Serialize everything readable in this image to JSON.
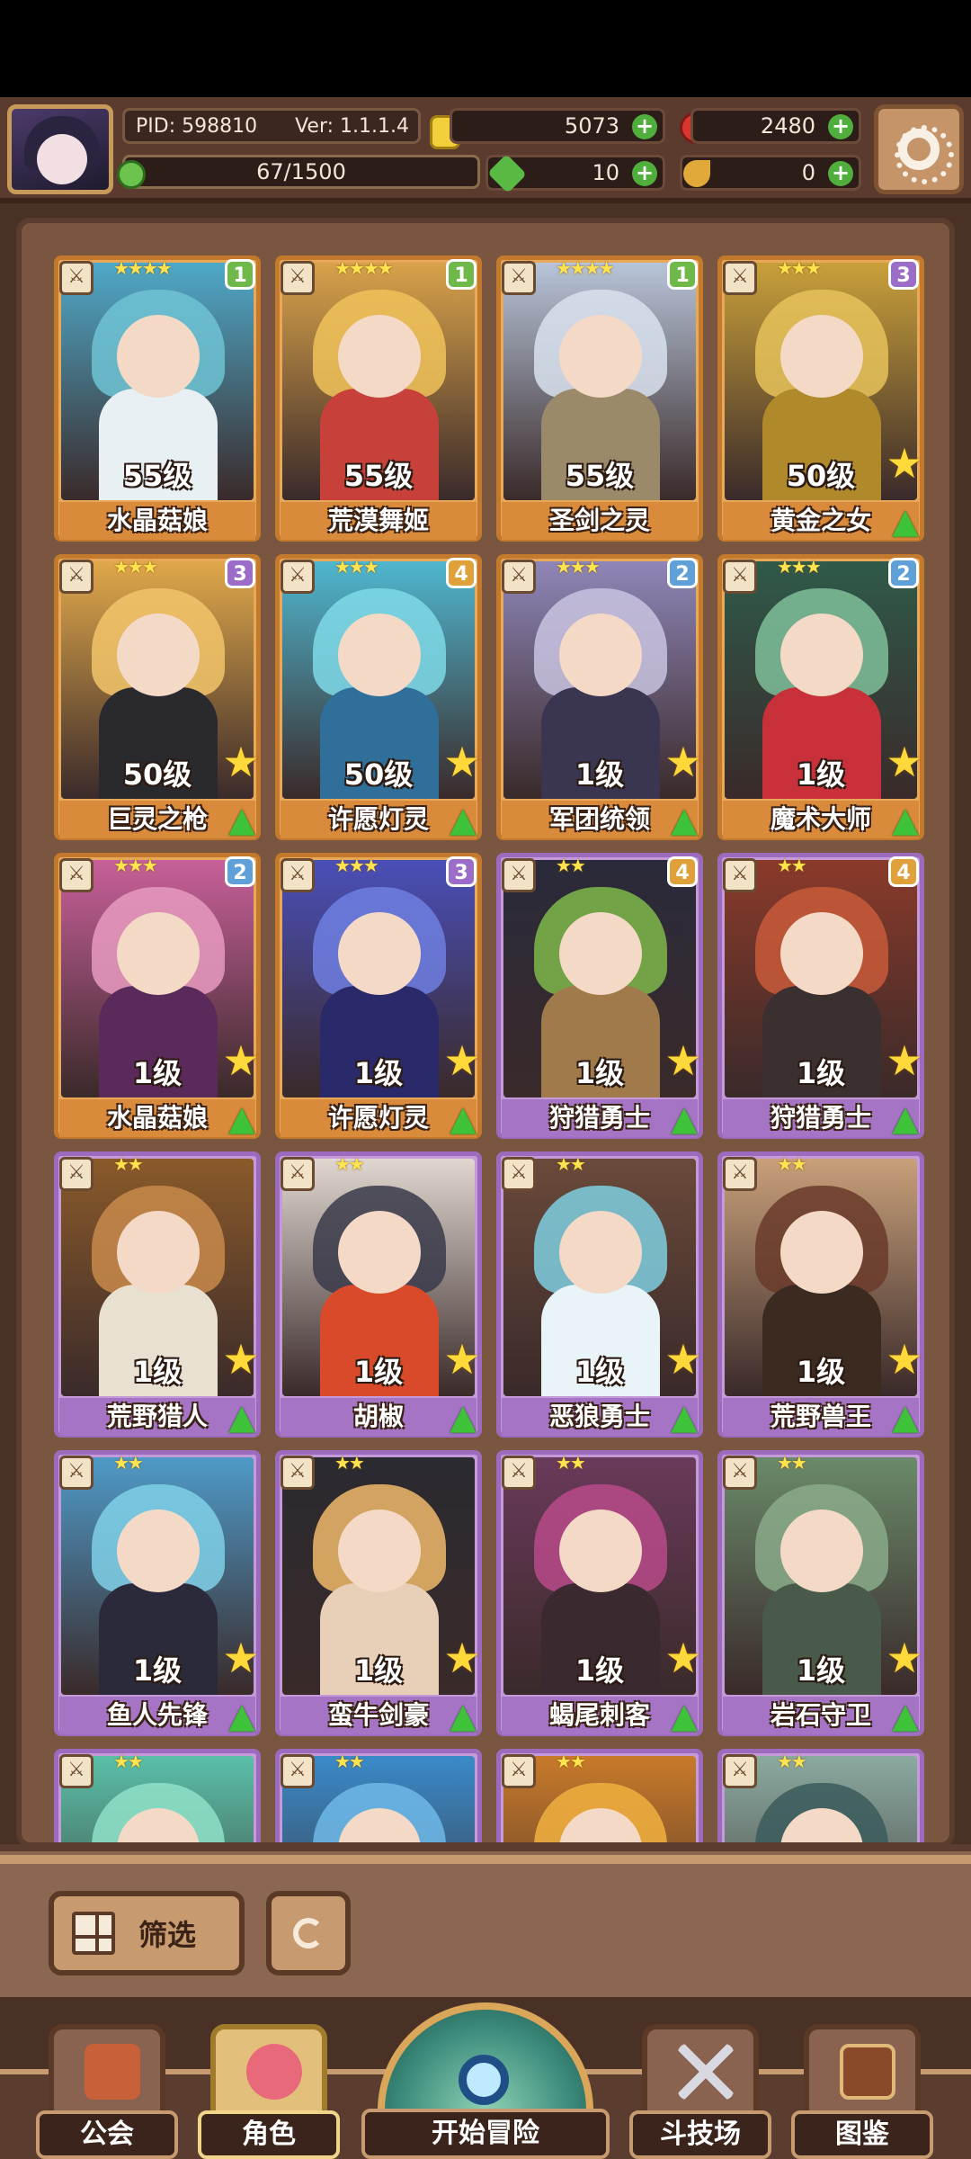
{
  "hud": {
    "pid": "PID: 598810",
    "version": "Ver: 1.1.1.4",
    "gold": "5073",
    "gems": "2480",
    "stamina": "67/1500",
    "clover": "10",
    "horn": "0"
  },
  "cards": [
    {
      "name": "水晶菇娘",
      "level": "55级",
      "stars": "★★★★",
      "badge": "1",
      "rarity": "gold",
      "badge_color": "#6fb84a",
      "art": [
        "#6fc3d4",
        "#4fa9c9",
        "#e8f0f4"
      ],
      "show_actions": false
    },
    {
      "name": "荒漠舞姬",
      "level": "55级",
      "stars": "★★★★",
      "badge": "1",
      "rarity": "gold",
      "badge_color": "#6fb84a",
      "art": [
        "#f0c25a",
        "#d9a24a",
        "#c8403a"
      ],
      "show_actions": false
    },
    {
      "name": "圣剑之灵",
      "level": "55级",
      "stars": "★★★★",
      "badge": "1",
      "rarity": "gold",
      "badge_color": "#6fb84a",
      "art": [
        "#d9e2ef",
        "#b7c4d8",
        "#9a8a6a"
      ],
      "show_actions": false
    },
    {
      "name": "黄金之女",
      "level": "50级",
      "stars": "★★★",
      "badge": "3",
      "rarity": "gold",
      "badge_color": "#9b6cc8",
      "art": [
        "#e6c25a",
        "#c9a03a",
        "#b08a2a"
      ],
      "show_actions": true
    },
    {
      "name": "巨灵之枪",
      "level": "50级",
      "stars": "★★★",
      "badge": "3",
      "rarity": "gold",
      "badge_color": "#9b6cc8",
      "art": [
        "#f2c46a",
        "#e0a84a",
        "#2a2a2e"
      ],
      "show_actions": true
    },
    {
      "name": "许愿灯灵",
      "level": "50级",
      "stars": "★★★",
      "badge": "4",
      "rarity": "gold",
      "badge_color": "#e0a03a",
      "art": [
        "#7fd9e6",
        "#4fb7cf",
        "#2f6f9a"
      ],
      "show_actions": true
    },
    {
      "name": "军团统领",
      "level": "1级",
      "stars": "★★★",
      "badge": "2",
      "rarity": "gold",
      "badge_color": "#5fa0d9",
      "art": [
        "#c9c3e0",
        "#8f86b8",
        "#3a3550"
      ],
      "show_actions": true
    },
    {
      "name": "魔术大师",
      "level": "1级",
      "stars": "★★★",
      "badge": "2",
      "rarity": "gold",
      "badge_color": "#5fa0d9",
      "art": [
        "#7fbf9a",
        "#2f5a4a",
        "#c8303a"
      ],
      "show_actions": true
    },
    {
      "name": "水晶菇娘",
      "level": "1级",
      "stars": "★★★",
      "badge": "2",
      "rarity": "gold",
      "badge_color": "#5fa0d9",
      "art": [
        "#e89ac0",
        "#c8609a",
        "#5a2a5a"
      ],
      "show_actions": true
    },
    {
      "name": "许愿灯灵",
      "level": "1级",
      "stars": "★★★",
      "badge": "3",
      "rarity": "gold",
      "badge_color": "#9b6cc8",
      "art": [
        "#6f7fe0",
        "#4a4fb8",
        "#2a2a6a"
      ],
      "show_actions": true
    },
    {
      "name": "狩猎勇士",
      "level": "1级",
      "stars": "★★",
      "badge": "4",
      "rarity": "purple",
      "badge_color": "#e0a03a",
      "art": [
        "#7fb84a",
        "#2a2a3a",
        "#a07a4a"
      ],
      "show_actions": true
    },
    {
      "name": "狩猎勇士",
      "level": "1级",
      "stars": "★★",
      "badge": "4",
      "rarity": "purple",
      "badge_color": "#e0a03a",
      "art": [
        "#c85a3a",
        "#8a3a2a",
        "#3a3030"
      ],
      "show_actions": true
    },
    {
      "name": "荒野猎人",
      "level": "1级",
      "stars": "★★",
      "badge": "",
      "rarity": "purple",
      "badge_color": "",
      "art": [
        "#c88a4a",
        "#8a5a2a",
        "#e8e0d0"
      ],
      "show_actions": true
    },
    {
      "name": "胡椒",
      "level": "1级",
      "stars": "★★",
      "badge": "",
      "rarity": "purple",
      "badge_color": "",
      "art": [
        "#3a3a4a",
        "#e0d8d0",
        "#d94a2a"
      ],
      "show_actions": true
    },
    {
      "name": "恶狼勇士",
      "level": "1级",
      "stars": "★★",
      "badge": "",
      "rarity": "purple",
      "badge_color": "",
      "art": [
        "#7fcfe0",
        "#6a4a3a",
        "#e8f4f8"
      ],
      "show_actions": true
    },
    {
      "name": "荒野兽王",
      "level": "1级",
      "stars": "★★",
      "badge": "",
      "rarity": "purple",
      "badge_color": "",
      "art": [
        "#6a3a2a",
        "#c8a07a",
        "#3a2a20"
      ],
      "show_actions": true
    },
    {
      "name": "鱼人先锋",
      "level": "1级",
      "stars": "★★",
      "badge": "",
      "rarity": "purple",
      "badge_color": "",
      "art": [
        "#7fd0e8",
        "#4f9ac8",
        "#2a2a3a"
      ],
      "show_actions": true
    },
    {
      "name": "蛮牛剑豪",
      "level": "1级",
      "stars": "★★",
      "badge": "",
      "rarity": "purple",
      "badge_color": "",
      "art": [
        "#f0b86a",
        "#2a2a30",
        "#e8d0b8"
      ],
      "show_actions": true
    },
    {
      "name": "蝎尾刺客",
      "level": "1级",
      "stars": "★★",
      "badge": "",
      "rarity": "purple",
      "badge_color": "",
      "art": [
        "#b84a8a",
        "#6a3a5a",
        "#3a2a30"
      ],
      "show_actions": true
    },
    {
      "name": "岩石守卫",
      "level": "1级",
      "stars": "★★",
      "badge": "",
      "rarity": "purple",
      "badge_color": "",
      "art": [
        "#8aaa8a",
        "#6a8a6a",
        "#4a5a4a"
      ],
      "show_actions": true
    },
    {
      "name": "",
      "level": "",
      "stars": "★★",
      "badge": "",
      "rarity": "purple",
      "badge_color": "",
      "art": [
        "#8fe0c8",
        "#5ac0a8",
        "#a06a9a"
      ],
      "show_actions": false
    },
    {
      "name": "",
      "level": "",
      "stars": "★★",
      "badge": "",
      "rarity": "purple",
      "badge_color": "",
      "art": [
        "#6fb8e8",
        "#3a8ac8",
        "#a06a9a"
      ],
      "show_actions": false
    },
    {
      "name": "",
      "level": "",
      "stars": "★★",
      "badge": "",
      "rarity": "purple",
      "badge_color": "",
      "art": [
        "#f0b040",
        "#c87a2a",
        "#3a2a20"
      ],
      "show_actions": false
    },
    {
      "name": "",
      "level": "",
      "stars": "★★",
      "badge": "",
      "rarity": "purple",
      "badge_color": "",
      "art": [
        "#3a5a5a",
        "#8aaaa0",
        "#2a3a3a"
      ],
      "show_actions": false
    }
  ],
  "filter": {
    "label": "筛选"
  },
  "nav": {
    "guild": "公会",
    "characters": "角色",
    "adventure": "开始冒险",
    "arena": "斗技场",
    "codex": "图鉴"
  },
  "colors": {
    "accent_green": "#4fae3c",
    "frame_brown": "#5b3d2f"
  }
}
